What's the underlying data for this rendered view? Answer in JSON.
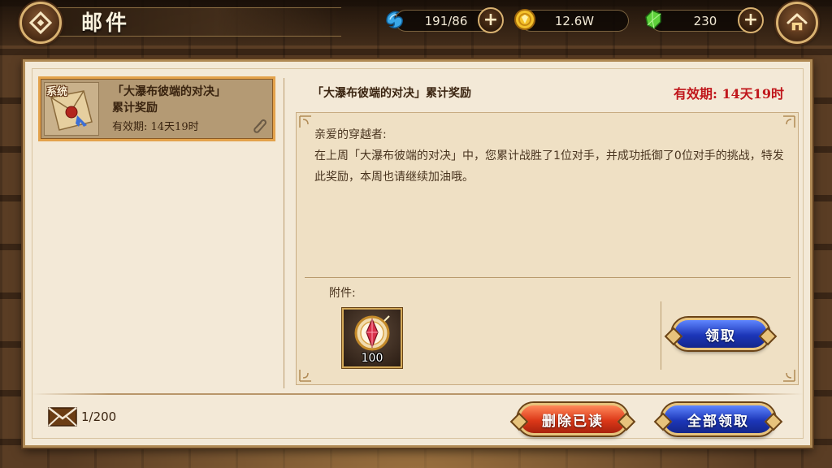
{
  "header": {
    "title": "邮件",
    "resources": [
      {
        "icon": "water-crystal-icon",
        "value": "191/86",
        "has_plus": true
      },
      {
        "icon": "gold-coin-icon",
        "value": "12.6W",
        "has_plus": false
      },
      {
        "icon": "green-gem-icon",
        "value": "230",
        "has_plus": true
      }
    ]
  },
  "mail_list": {
    "items": [
      {
        "tag": "系统",
        "title": "「大瀑布彼端的对决」累计奖励",
        "expiry": "有效期:  14天19时",
        "has_attachment": true,
        "selected": true
      }
    ],
    "count": "1/200"
  },
  "detail": {
    "title": "「大瀑布彼端的对决」累计奖励",
    "expiry": "有效期:  14天19时",
    "greeting": "亲爱的穿越者:",
    "body": "在上周「大瀑布彼端的对决」中，您累计战胜了1位对手，并成功抵御了0位对手的挑战，特发此奖励，本周也请继续加油哦。",
    "attachment_label": "附件:",
    "attachments": [
      {
        "icon": "crystal-medal-icon",
        "count": "100"
      }
    ],
    "claim_label": "领取"
  },
  "footer": {
    "delete_read_label": "删除已读",
    "claim_all_label": "全部领取"
  },
  "colors": {
    "expiry_red": "#c0161b",
    "button_blue": "#1c36b8",
    "button_red": "#dc3818",
    "frame_gold": "#d9b271"
  }
}
